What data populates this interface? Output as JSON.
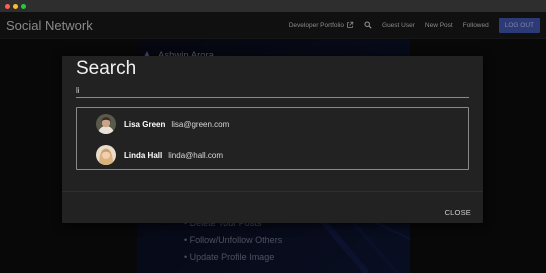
{
  "app": {
    "brand": "Social Network"
  },
  "nav": {
    "developer_portfolio": "Developer Portfolio",
    "guest_user": "Guest User",
    "new_post": "New Post",
    "followed": "Followed",
    "logout": "LOG OUT"
  },
  "background": {
    "profile_name": "Ashwin Arora",
    "features": [
      "Delete Your Posts",
      "Follow/Unfollow Others",
      "Update Profile Image"
    ]
  },
  "modal": {
    "title": "Search",
    "query": "li",
    "results": [
      {
        "name": "Lisa Green",
        "email": "lisa@green.com"
      },
      {
        "name": "Linda Hall",
        "email": "linda@hall.com"
      }
    ],
    "close_label": "CLOSE"
  },
  "colors": {
    "logout_bg": "#2c3b75",
    "modal_bg": "#222222",
    "navbar_bg": "#101010"
  }
}
